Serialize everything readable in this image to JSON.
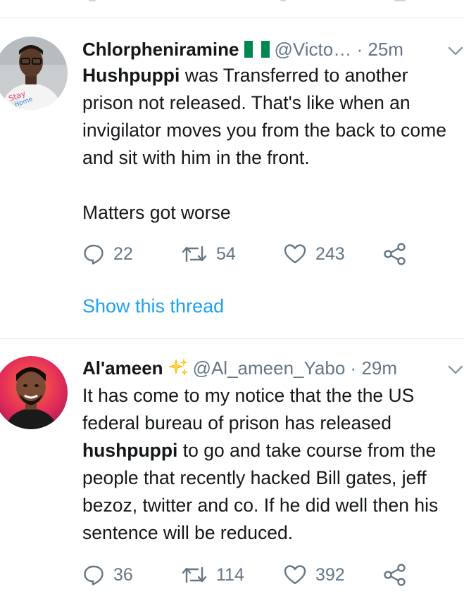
{
  "colors": {
    "accent": "#1da1f2",
    "text": "#14171a",
    "muted": "#657786",
    "divider": "#e1e8ed",
    "flag_green": "#008751"
  },
  "tweets": [
    {
      "name": "Chlorpheniramine",
      "badge": "nigeria-flag",
      "handle": "@Victo…",
      "separator": "·",
      "time": "25m",
      "text_highlight": "Hushpuppi",
      "text_rest": " was Transferred to another prison not released. That's like when an invigilator moves you from the back to come and sit with him in the front.\n\nMatters got worse",
      "replies": "22",
      "retweets": "54",
      "likes": "243",
      "show_thread": "Show this thread"
    },
    {
      "name": "Al'ameen",
      "badge": "sparkles",
      "handle": "@Al_ameen_Yabo",
      "separator": "·",
      "time": "29m",
      "text_before": "It has come to my notice that the the US federal bureau of prison has released ",
      "text_highlight": "hushpuppi",
      "text_after": " to go and take course from the people that recently hacked Bill gates, jeff bezoz, twitter and co. If he did well then his sentence will be reduced.",
      "replies": "36",
      "retweets": "114",
      "likes": "392"
    }
  ],
  "icons": {
    "reply": "reply-icon",
    "retweet": "retweet-icon",
    "like": "heart-icon",
    "share": "share-icon",
    "more": "chevron-down-icon"
  }
}
